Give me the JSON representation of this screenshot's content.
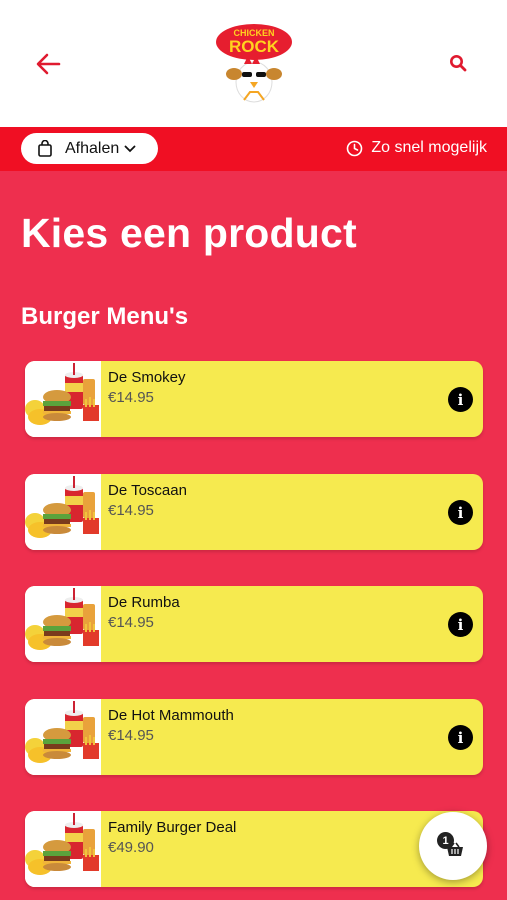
{
  "header": {
    "back_icon": "arrow-left-icon",
    "search_icon": "search-icon",
    "logo_text_top": "CHICKEN",
    "logo_text_bottom": "ROCK"
  },
  "subbar": {
    "mode_label": "Afhalen",
    "mode_icon": "shopping-bag-icon",
    "time_label": "Zo snel mogelijk",
    "time_icon": "clock-icon"
  },
  "page_title": "Kies een product",
  "section_title": "Burger Menu's",
  "products": [
    {
      "name": "De Smokey",
      "price": "€14.95"
    },
    {
      "name": "De Toscaan",
      "price": "€14.95"
    },
    {
      "name": "De Rumba",
      "price": "€14.95"
    },
    {
      "name": "De Hot Mammouth",
      "price": "€14.95"
    },
    {
      "name": "Family Burger Deal",
      "price": "€49.90"
    }
  ],
  "cart": {
    "count": "1",
    "icon": "basket-icon"
  },
  "colors": {
    "primary": "#ee2f4e",
    "bar": "#f00f23",
    "card": "#f6ea4f"
  }
}
